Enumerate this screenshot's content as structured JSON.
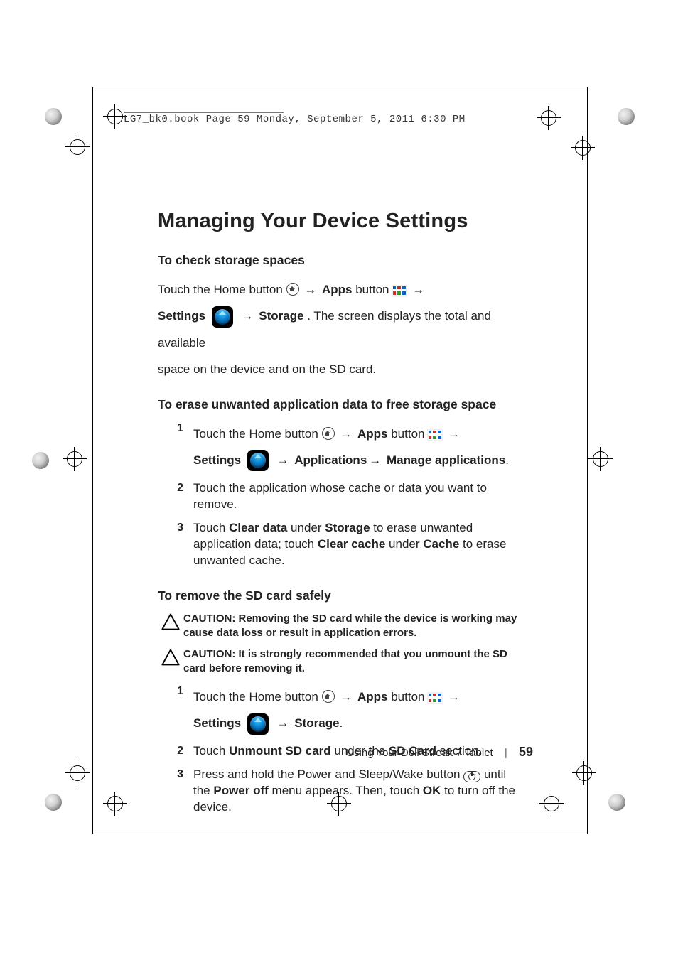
{
  "header": {
    "running_text": "LG7_bk0.book  Page 59  Monday, September 5, 2011  6:30 PM"
  },
  "footer": {
    "book_title": "Using Your Dell Streak 7 Tablet",
    "page_number": "59"
  },
  "labels": {
    "apps": "Apps",
    "button_word": " button ",
    "settings": "Settings",
    "storage": "Storage",
    "applications": "Applications",
    "manage_apps": "Manage applications",
    "clear_data": "Clear data",
    "clear_cache": "Clear cache",
    "cache": "Cache",
    "unmount_sd": "Unmount SD card",
    "sd_card": "SD Card",
    "power_off": "Power off",
    "ok": "OK",
    "caution": "CAUTION: "
  },
  "content": {
    "title": "Managing Your Device Settings",
    "section1": {
      "heading": "To check storage spaces",
      "line1_a": "Touch the Home button ",
      "line2_rest": ". The screen displays the total and available",
      "line3": "space on the device and on the SD card."
    },
    "section2": {
      "heading": "To erase unwanted application data to free storage space",
      "step1_a": "Touch the Home button ",
      "step2": "Touch the application whose cache or data you want to remove.",
      "step3_a": "Touch ",
      "step3_b": " under ",
      "step3_c": " to erase unwanted application data; touch ",
      "step3_d": " under ",
      "step3_e": " to erase unwanted cache."
    },
    "section3": {
      "heading": "To remove the SD card safely",
      "caution1": "Removing the SD card while the device is working may cause data loss or result in application errors.",
      "caution2": "It is strongly recommended that you unmount the SD card before removing it.",
      "step1_a": "Touch the Home button ",
      "step2_a": "Touch ",
      "step2_b": " under the ",
      "step2_c": " section.",
      "step3_a": "Press and hold the Power and Sleep/Wake button ",
      "step3_b": " until the ",
      "step3_c": " menu appears. Then, touch ",
      "step3_d": " to turn off the device."
    }
  }
}
